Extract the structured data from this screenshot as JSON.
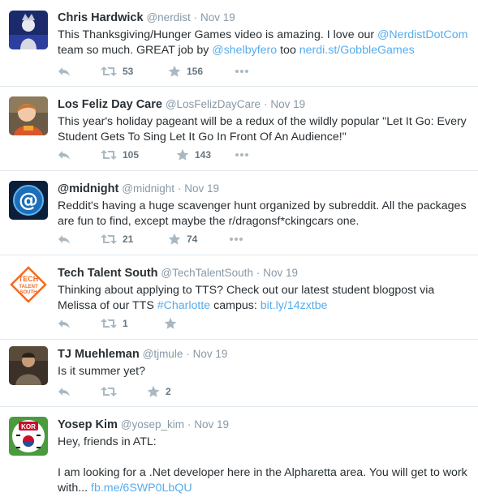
{
  "tweets": [
    {
      "name": "Chris Hardwick",
      "handle": "@nerdist",
      "sep": "·",
      "time": "Nov 19",
      "text_lines": [
        [
          {
            "t": "This Thanksgiving/Hunger Games video is amazing. I love our ",
            "link": false
          },
          {
            "t": "@NerdistDotCom",
            "link": true
          }
        ],
        [
          {
            "t": "team so much. GREAT job by ",
            "link": false
          },
          {
            "t": "@shelbyfero",
            "link": true
          },
          {
            "t": " too ",
            "link": false
          },
          {
            "t": "nerdi.st/GobbleGames",
            "link": true
          }
        ]
      ],
      "retweets": "53",
      "favorites": "156",
      "avatar_icon": "person-costume-avatar"
    },
    {
      "name": "Los Feliz Day Care",
      "handle": "@LosFelizDayCare",
      "sep": "·",
      "time": "Nov 19",
      "text_lines": [
        [
          {
            "t": "This year's holiday pageant will be a redux of the wildly popular \"Let It Go: Every",
            "link": false
          }
        ],
        [
          {
            "t": "Student Gets To Sing Let It Go In Front Of An Audience!\"",
            "link": false
          }
        ]
      ],
      "retweets": "105",
      "favorites": "143",
      "avatar_icon": "child-photo-avatar"
    },
    {
      "name": "@midnight",
      "handle": "@midnight",
      "sep": "·",
      "time": "Nov 19",
      "text_lines": [
        [
          {
            "t": "Reddit's having a huge scavenger hunt organized by subreddit. All the packages",
            "link": false
          }
        ],
        [
          {
            "t": "are fun to find, except maybe the r/dragonsf*ckingcars one.",
            "link": false
          }
        ]
      ],
      "retweets": "21",
      "favorites": "74",
      "avatar_icon": "at-sign-logo-avatar"
    },
    {
      "name": "Tech Talent South",
      "handle": "@TechTalentSouth",
      "sep": "·",
      "time": "Nov 19",
      "text_lines": [
        [
          {
            "t": "Thinking about applying to TTS? Check out our latest student blogpost via",
            "link": false
          }
        ],
        [
          {
            "t": "Melissa of our TTS ",
            "link": false
          },
          {
            "t": "#Charlotte",
            "link": true
          },
          {
            "t": " campus: ",
            "link": false
          },
          {
            "t": "bit.ly/14zxtbe",
            "link": true
          }
        ]
      ],
      "retweets": "1",
      "favorites": "",
      "avatar_icon": "tech-talent-south-logo",
      "avatar_text": [
        "TECH",
        "TALENT",
        "SOUTH"
      ]
    },
    {
      "name": "TJ Muehleman",
      "handle": "@tjmule",
      "sep": "·",
      "time": "Nov 19",
      "text_lines": [
        [
          {
            "t": "Is it summer yet?",
            "link": false
          }
        ]
      ],
      "retweets": "",
      "favorites": "2",
      "avatar_icon": "man-photo-avatar"
    },
    {
      "name": "Yosep Kim",
      "handle": "@yosep_kim",
      "sep": "·",
      "time": "Nov 19",
      "text_lines": [
        [
          {
            "t": "Hey, friends in ATL:",
            "link": false
          }
        ],
        [
          {
            "t": "",
            "link": false
          }
        ],
        [
          {
            "t": "I am looking for a .Net developer here in the Alpharetta area. You will get to work",
            "link": false
          }
        ],
        [
          {
            "t": "with... ",
            "link": false
          },
          {
            "t": "fb.me/6SWP0LbQU",
            "link": true
          }
        ]
      ],
      "retweets": "",
      "favorites": "",
      "avatar_icon": "kor-flag-badge-avatar",
      "avatar_text": [
        "KOR"
      ]
    }
  ]
}
